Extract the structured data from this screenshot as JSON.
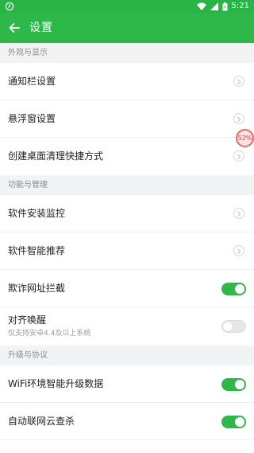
{
  "status_bar": {
    "time": "5:21",
    "battery_icon": "battery-icon",
    "wifi_icon": "wifi-icon",
    "signal_icon": "signal-icon"
  },
  "app_bar": {
    "title": "设置",
    "back_icon": "back-arrow-icon"
  },
  "sections": [
    {
      "header": "外观与显示",
      "items": [
        {
          "label": "通知栏设置",
          "control": "chevron"
        },
        {
          "label": "悬浮窗设置",
          "control": "chevron"
        },
        {
          "label": "创建桌面清理快捷方式",
          "control": "chevron"
        }
      ]
    },
    {
      "header": "功能与管理",
      "items": [
        {
          "label": "软件安装监控",
          "control": "chevron"
        },
        {
          "label": "软件智能推荐",
          "control": "chevron"
        },
        {
          "label": "欺诈网址拦截",
          "control": "toggle",
          "on": true
        },
        {
          "label": "对齐唤醒",
          "sublabel": "仅支持安卓4.4及以上系统",
          "control": "toggle",
          "on": false
        }
      ]
    },
    {
      "header": "升级与协议",
      "items": [
        {
          "label": "WiFi环境智能升级数据",
          "control": "toggle",
          "on": true
        },
        {
          "label": "自动联网云查杀",
          "control": "toggle",
          "on": true
        }
      ]
    }
  ],
  "floating_ball": {
    "text": "52%"
  },
  "colors": {
    "accent": "#2fb84a",
    "status_bar": "#28b446",
    "section_bg": "#f2f3f5"
  }
}
